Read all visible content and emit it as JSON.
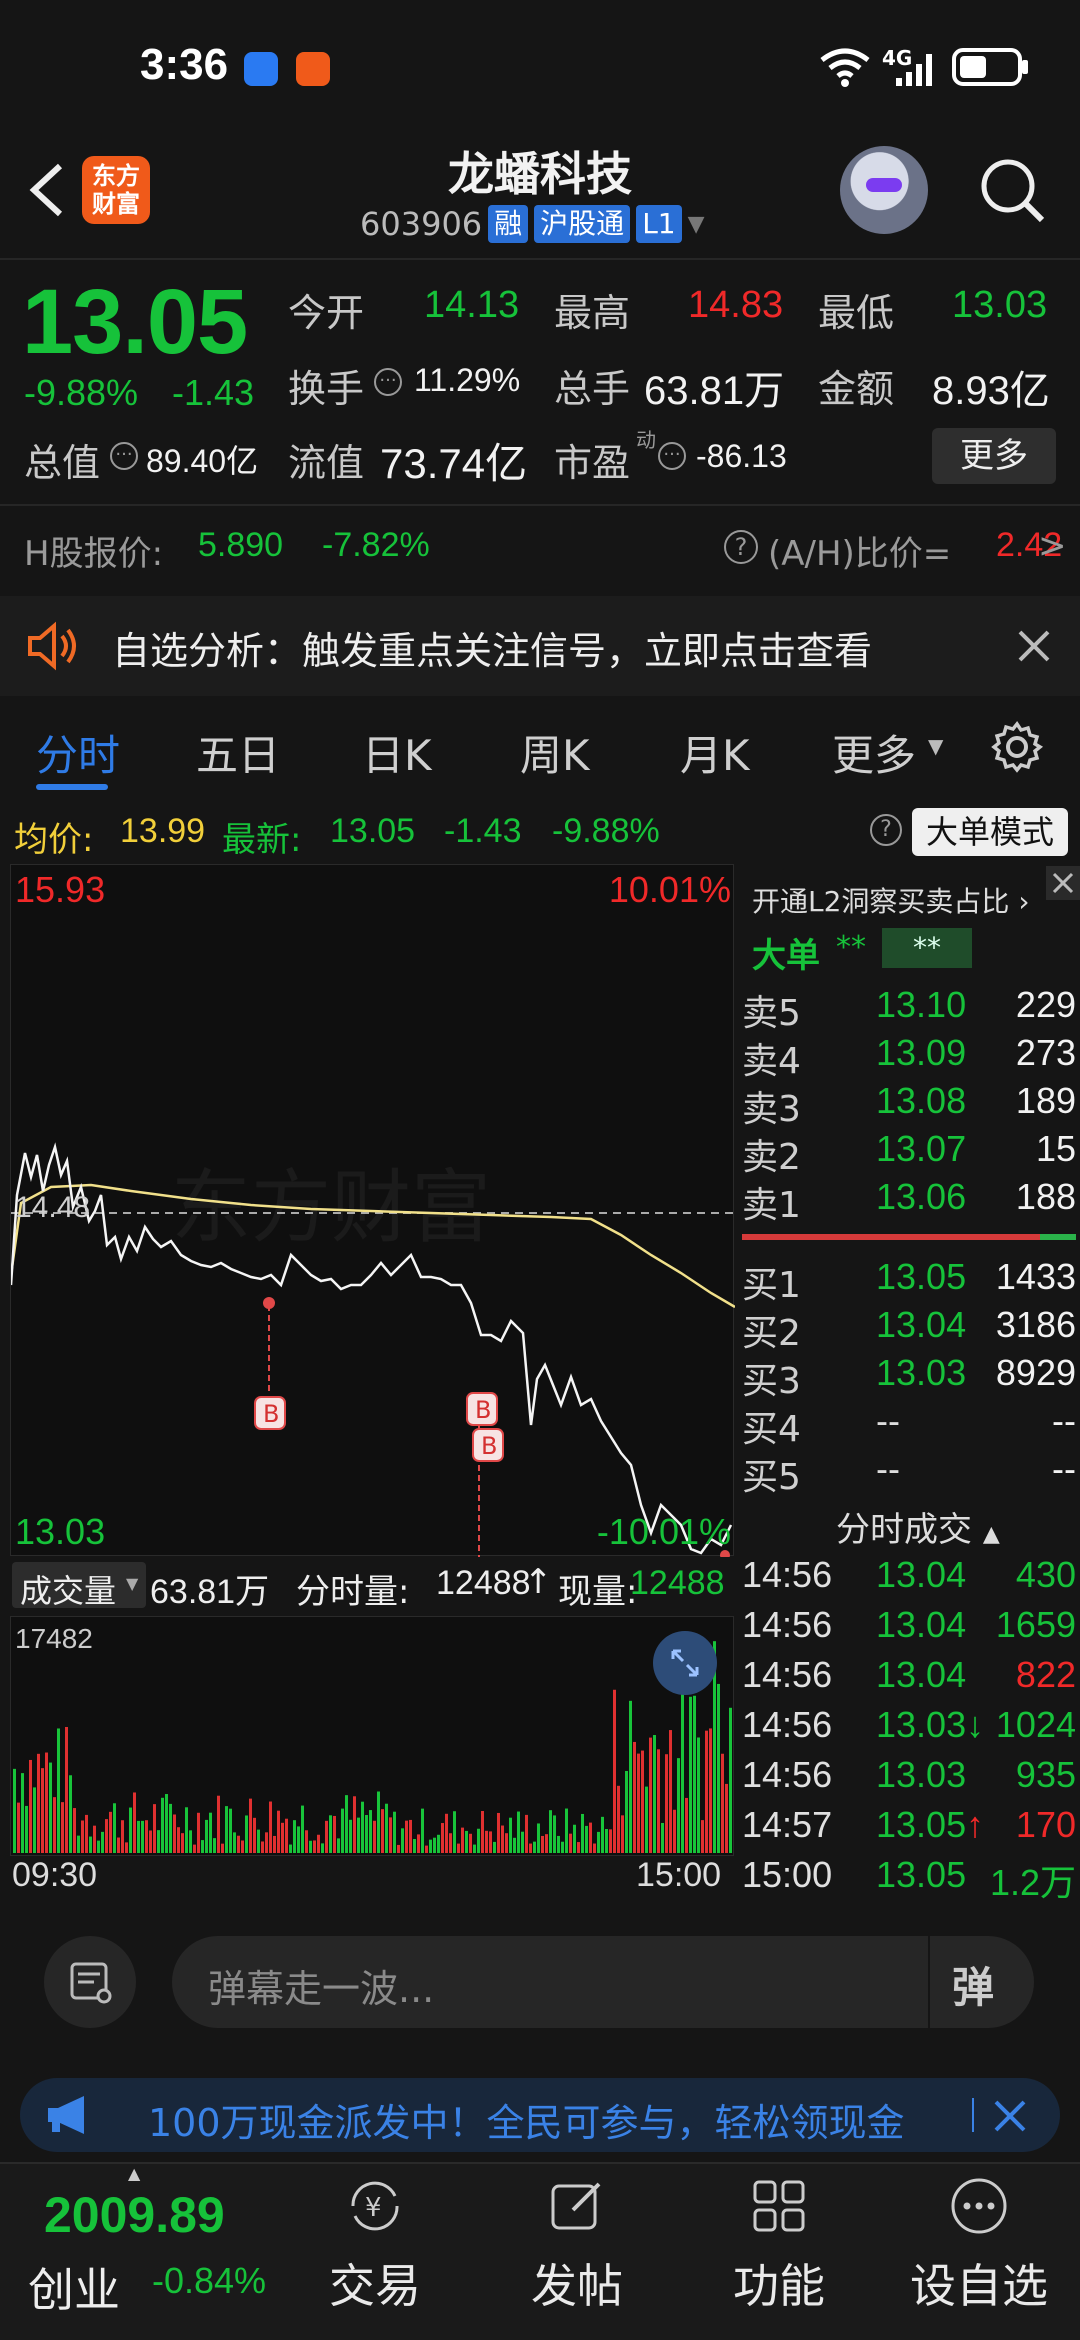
{
  "status": {
    "time": "3:36",
    "network": "4G"
  },
  "header": {
    "logo": "东方财富",
    "stock_name": "龙蟠科技",
    "stock_code": "603906",
    "badges": [
      "融",
      "沪股通",
      "L1"
    ]
  },
  "quote": {
    "price": "13.05",
    "change_pct": "-9.88%",
    "change": "-1.43",
    "open_label": "今开",
    "open": "14.13",
    "high_label": "最高",
    "high": "14.83",
    "low_label": "最低",
    "low": "13.03",
    "turnover_label": "换手",
    "turnover": "11.29%",
    "volume_label": "总手",
    "volume": "63.81万",
    "amount_label": "金额",
    "amount": "8.93亿",
    "mktcap_label": "总值",
    "mktcap": "89.40亿",
    "float_label": "流值",
    "float": "73.74亿",
    "pe_label": "市盈",
    "pe_sup": "动",
    "pe": "-86.13",
    "more": "更多"
  },
  "hshare": {
    "label": "H股报价:",
    "price": "5.890",
    "change": "-7.82%",
    "ah_label": "(A/H)比价=",
    "ah_value": "2.42",
    "arrow": ">"
  },
  "notice": {
    "text": "自选分析：触发重点关注信号，立即点击查看"
  },
  "tabs": [
    "分时",
    "五日",
    "日K",
    "周K",
    "月K",
    "更多"
  ],
  "avg_row": {
    "avg_label": "均价:",
    "avg": "13.99",
    "last_label": "最新:",
    "last": "13.05",
    "chg": "-1.43",
    "pct": "-9.88%",
    "big_order": "大单模式"
  },
  "chart": {
    "top_price": "15.93",
    "top_pct": "10.01%",
    "bottom_price": "13.03",
    "bottom_pct": "-10.01%",
    "mid_price": "14.48",
    "watermark": "东方财富",
    "b_marker": "B"
  },
  "volume_bar": {
    "label": "成交量",
    "total": "63.81万",
    "minute_label": "分时量:",
    "minute": "12488",
    "now_label": "现量:",
    "now": "12488",
    "max": "17482",
    "start_time": "09:30",
    "end_time": "15:00"
  },
  "book": {
    "l2_link": "开通L2洞察买卖占比",
    "big_label": "大单",
    "big_val1": "**",
    "big_val2": "**",
    "asks": [
      {
        "label": "卖5",
        "price": "13.10",
        "vol": "229"
      },
      {
        "label": "卖4",
        "price": "13.09",
        "vol": "273"
      },
      {
        "label": "卖3",
        "price": "13.08",
        "vol": "189"
      },
      {
        "label": "卖2",
        "price": "13.07",
        "vol": "15"
      },
      {
        "label": "卖1",
        "price": "13.06",
        "vol": "188"
      }
    ],
    "bids": [
      {
        "label": "买1",
        "price": "13.05",
        "vol": "1433"
      },
      {
        "label": "买2",
        "price": "13.04",
        "vol": "3186"
      },
      {
        "label": "买3",
        "price": "13.03",
        "vol": "8929"
      },
      {
        "label": "买4",
        "price": "--",
        "vol": "--"
      },
      {
        "label": "买5",
        "price": "--",
        "vol": "--"
      }
    ],
    "trades_title": "分时成交",
    "trades": [
      {
        "time": "14:56",
        "price": "13.04",
        "vol": "430",
        "dir": ""
      },
      {
        "time": "14:56",
        "price": "13.04",
        "vol": "1659",
        "dir": ""
      },
      {
        "time": "14:56",
        "price": "13.04",
        "vol": "822",
        "dir": ""
      },
      {
        "time": "14:56",
        "price": "13.03",
        "vol": "1024",
        "dir": "↓"
      },
      {
        "time": "14:56",
        "price": "13.03",
        "vol": "935",
        "dir": ""
      },
      {
        "time": "14:57",
        "price": "13.05",
        "vol": "170",
        "dir": "↑"
      },
      {
        "time": "15:00",
        "price": "13.05",
        "vol": "1.2万",
        "dir": ""
      }
    ]
  },
  "danmu": {
    "placeholder": "弹幕走一波...",
    "button": "弹"
  },
  "ad": {
    "text": "100万现金派发中！全民可参与，轻松领现金"
  },
  "nav": {
    "index_value": "2009.89",
    "index_name": "创业",
    "index_change": "-0.84%",
    "items": [
      "交易",
      "发帖",
      "功能",
      "设自选"
    ]
  },
  "colors": {
    "up": "#f02929",
    "down": "#16c23a",
    "accent": "#2f7be6",
    "avg_line": "#f1e08a"
  }
}
